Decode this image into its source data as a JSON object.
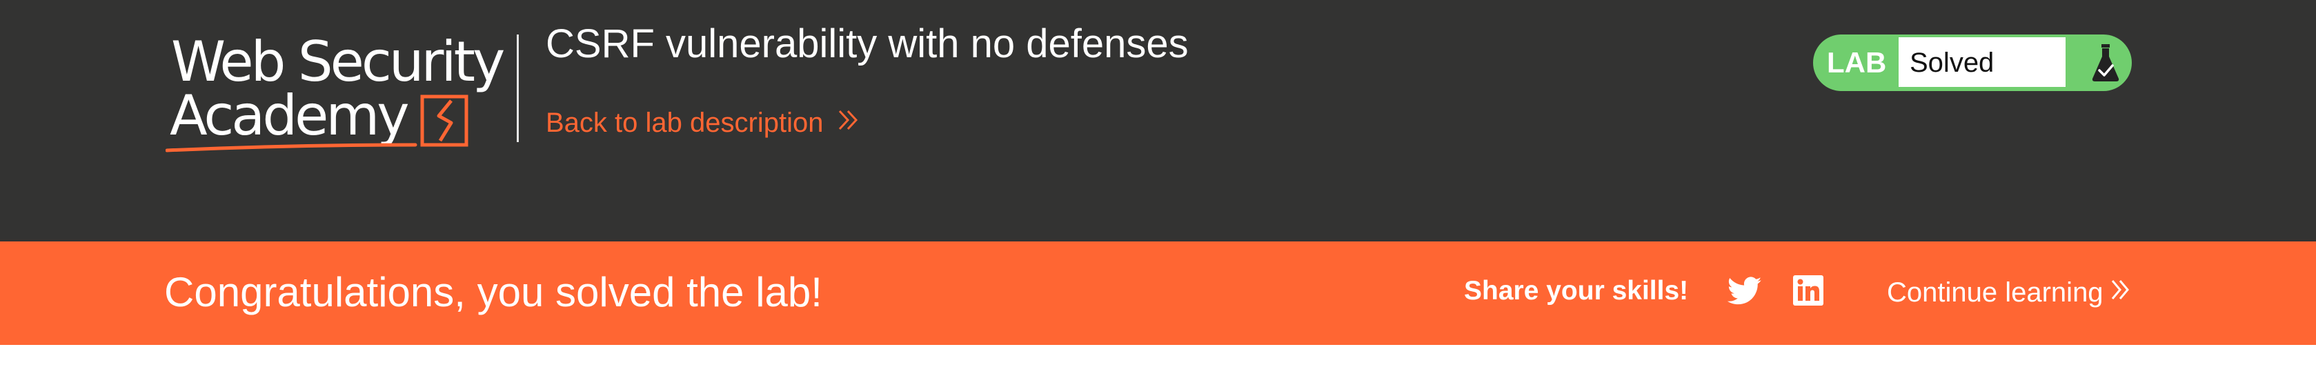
{
  "header": {
    "logo": {
      "line1": "Web Security",
      "line2": "Academy",
      "icon": "academy-bolt-logo"
    },
    "lab_title": "CSRF vulnerability with no defenses",
    "back_link": {
      "label": "Back to lab description",
      "icon": "double-chevron-right-icon"
    },
    "lab_status": {
      "tag": "LAB",
      "status": "Solved",
      "icon": "flask-check-icon"
    }
  },
  "banner": {
    "message": "Congratulations, you solved the lab!",
    "share_label": "Share your skills!",
    "social_icons": [
      "twitter-icon",
      "linkedin-icon"
    ],
    "continue_label": "Continue learning",
    "continue_icon": "double-chevron-right-icon"
  },
  "colors": {
    "header_bg": "#333332",
    "accent": "#ff6633",
    "solved_green": "#70ce6e",
    "text_white": "#ffffff"
  }
}
